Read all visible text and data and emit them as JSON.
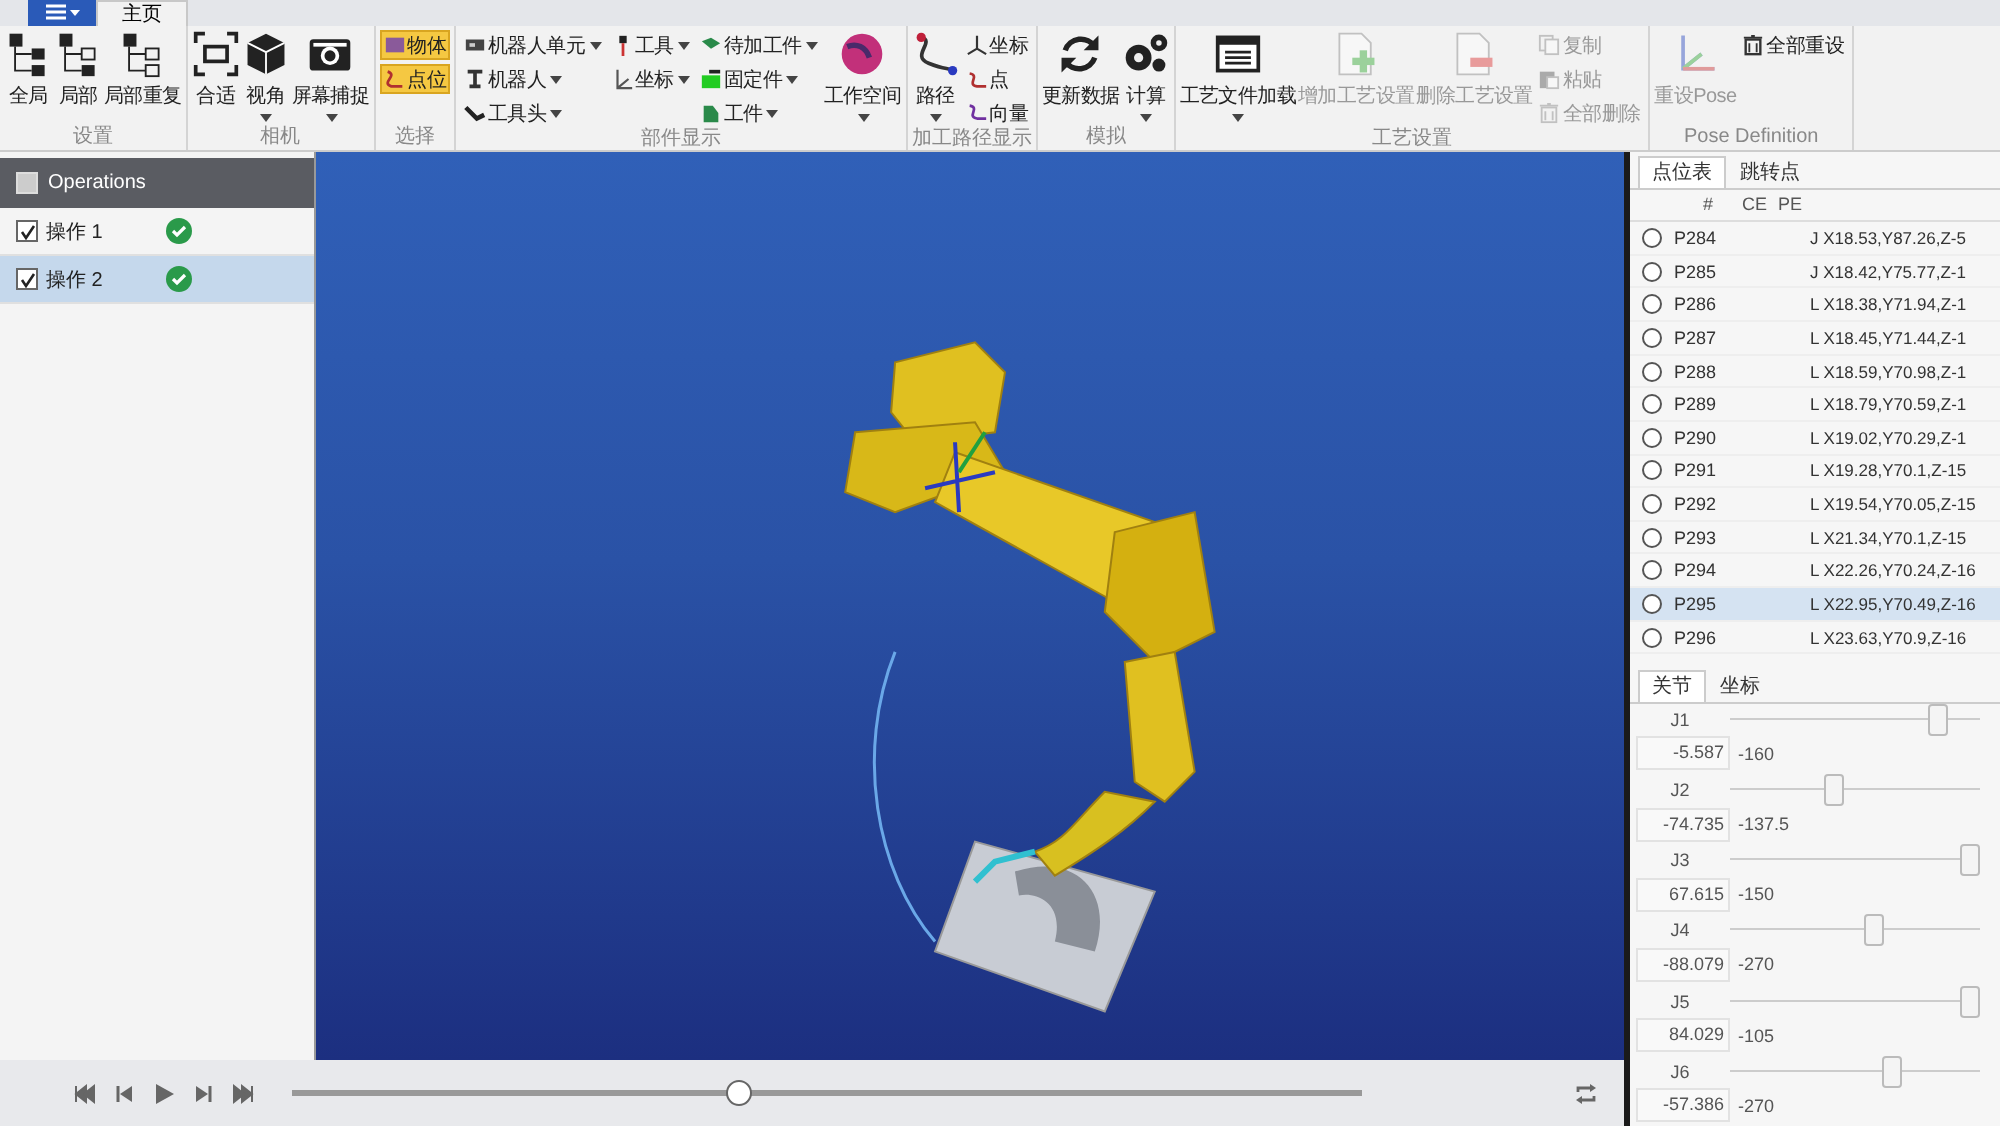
{
  "tabs": [
    {
      "label": "主页",
      "selected": true
    }
  ],
  "ribbon": {
    "groups": [
      {
        "title": "设置",
        "items": [
          {
            "kind": "large",
            "label": "全局",
            "dropdown": false,
            "disabled": false
          },
          {
            "kind": "large",
            "label": "局部",
            "dropdown": false,
            "disabled": false
          },
          {
            "kind": "large",
            "label": "局部重复",
            "dropdown": false,
            "disabled": false
          }
        ]
      },
      {
        "title": "相机",
        "items": [
          {
            "kind": "large",
            "label": "合适",
            "dropdown": false,
            "disabled": false
          },
          {
            "kind": "large",
            "label": "视角",
            "dropdown": true,
            "disabled": false
          },
          {
            "kind": "large",
            "label": "屏幕捕捉",
            "dropdown": true,
            "disabled": false
          }
        ]
      },
      {
        "title": "选择",
        "items": [
          {
            "kind": "column",
            "items": [
              {
                "label": "物体",
                "dropdown": false,
                "highlighted": true,
                "disabled": false
              },
              {
                "label": "点位",
                "dropdown": false,
                "highlighted": true,
                "disabled": false
              }
            ]
          }
        ]
      },
      {
        "title": "部件显示",
        "items": [
          {
            "kind": "column",
            "items": [
              {
                "label": "机器人单元",
                "dropdown": true,
                "highlighted": false,
                "disabled": false
              },
              {
                "label": "机器人",
                "dropdown": true,
                "highlighted": false,
                "disabled": false
              },
              {
                "label": "工具头",
                "dropdown": true,
                "highlighted": false,
                "disabled": false
              }
            ]
          },
          {
            "kind": "column",
            "items": [
              {
                "label": "工具",
                "dropdown": true,
                "highlighted": false,
                "disabled": false
              },
              {
                "label": "坐标",
                "dropdown": true,
                "highlighted": false,
                "disabled": false
              }
            ]
          },
          {
            "kind": "column",
            "items": [
              {
                "label": "待加工件",
                "dropdown": true,
                "highlighted": false,
                "disabled": false
              },
              {
                "label": "固定件",
                "dropdown": true,
                "highlighted": false,
                "disabled": false
              },
              {
                "label": "工件",
                "dropdown": true,
                "highlighted": false,
                "disabled": false
              }
            ]
          },
          {
            "kind": "large",
            "label": "工作空间",
            "dropdown": true,
            "disabled": false
          }
        ]
      },
      {
        "title": "加工路径显示",
        "items": [
          {
            "kind": "large",
            "label": "路径",
            "dropdown": true,
            "disabled": false
          },
          {
            "kind": "column",
            "items": [
              {
                "label": "坐标",
                "dropdown": false,
                "highlighted": false,
                "disabled": false
              },
              {
                "label": "点",
                "dropdown": false,
                "highlighted": false,
                "disabled": false
              },
              {
                "label": "向量",
                "dropdown": false,
                "highlighted": false,
                "disabled": false
              }
            ]
          }
        ]
      },
      {
        "title": "模拟",
        "items": [
          {
            "kind": "large",
            "label": "更新数据",
            "dropdown": false,
            "disabled": false
          },
          {
            "kind": "large",
            "label": "计算",
            "dropdown": true,
            "disabled": false
          }
        ]
      },
      {
        "title": "工艺设置",
        "items": [
          {
            "kind": "large",
            "label": "工艺文件加载",
            "dropdown": true,
            "disabled": false
          },
          {
            "kind": "large",
            "label": "增加工艺设置",
            "dropdown": false,
            "disabled": true
          },
          {
            "kind": "large",
            "label": "删除工艺设置",
            "dropdown": false,
            "disabled": true
          },
          {
            "kind": "column",
            "items": [
              {
                "label": "复制",
                "dropdown": false,
                "highlighted": false,
                "disabled": true
              },
              {
                "label": "粘贴",
                "dropdown": false,
                "highlighted": false,
                "disabled": true
              },
              {
                "label": "全部删除",
                "dropdown": false,
                "highlighted": false,
                "disabled": true
              }
            ]
          }
        ]
      },
      {
        "title": "Pose Definition",
        "items": [
          {
            "kind": "large",
            "label": "重设Pose",
            "dropdown": false,
            "disabled": true
          },
          {
            "kind": "column",
            "items": [
              {
                "label": "全部重设",
                "dropdown": false,
                "highlighted": false,
                "disabled": false
              }
            ]
          }
        ]
      }
    ]
  },
  "operations": {
    "title": "Operations",
    "checked": false,
    "items": [
      {
        "label": "操作 1",
        "checked": true,
        "selected": false,
        "done": true
      },
      {
        "label": "操作 2",
        "checked": true,
        "selected": true,
        "done": true
      }
    ]
  },
  "playback": {
    "level": 0.415
  },
  "point_table": {
    "tabs": [
      {
        "label": "点位表",
        "selected": true
      },
      {
        "label": "跳转点",
        "selected": false
      }
    ],
    "columns": [
      "#",
      "CE",
      "PE"
    ],
    "rows": [
      {
        "name": "P284",
        "value": "J X18.53,Y87.26,Z-5",
        "selected": false
      },
      {
        "name": "P285",
        "value": "J X18.42,Y75.77,Z-1",
        "selected": false
      },
      {
        "name": "P286",
        "value": "L X18.38,Y71.94,Z-1",
        "selected": false
      },
      {
        "name": "P287",
        "value": "L X18.45,Y71.44,Z-1",
        "selected": false
      },
      {
        "name": "P288",
        "value": "L X18.59,Y70.98,Z-1",
        "selected": false
      },
      {
        "name": "P289",
        "value": "L X18.79,Y70.59,Z-1",
        "selected": false
      },
      {
        "name": "P290",
        "value": "L X19.02,Y70.29,Z-1",
        "selected": false
      },
      {
        "name": "P291",
        "value": "L X19.28,Y70.1,Z-15",
        "selected": false
      },
      {
        "name": "P292",
        "value": "L X19.54,Y70.05,Z-15",
        "selected": false
      },
      {
        "name": "P293",
        "value": "L X21.34,Y70.1,Z-15",
        "selected": false
      },
      {
        "name": "P294",
        "value": "L X22.26,Y70.24,Z-16",
        "selected": false
      },
      {
        "name": "P295",
        "value": "L X22.95,Y70.49,Z-16",
        "selected": true
      },
      {
        "name": "P296",
        "value": "L X23.63,Y70.9,Z-16",
        "selected": false
      }
    ]
  },
  "joints": {
    "tabs": [
      {
        "label": "关节",
        "selected": true
      },
      {
        "label": "坐标",
        "selected": false
      }
    ],
    "items": [
      {
        "name": "J1",
        "value": "-5.587",
        "min": "-160",
        "level": 0.86
      },
      {
        "name": "J2",
        "value": "-74.735",
        "min": "-137.5",
        "level": 0.41
      },
      {
        "name": "J3",
        "value": "67.615",
        "min": "-150",
        "level": 1
      },
      {
        "name": "J4",
        "value": "-88.079",
        "min": "-270",
        "level": 0.58
      },
      {
        "name": "J5",
        "value": "84.029",
        "min": "-105",
        "level": 1
      },
      {
        "name": "J6",
        "value": "-57.386",
        "min": "-270",
        "level": 0.66
      }
    ]
  }
}
